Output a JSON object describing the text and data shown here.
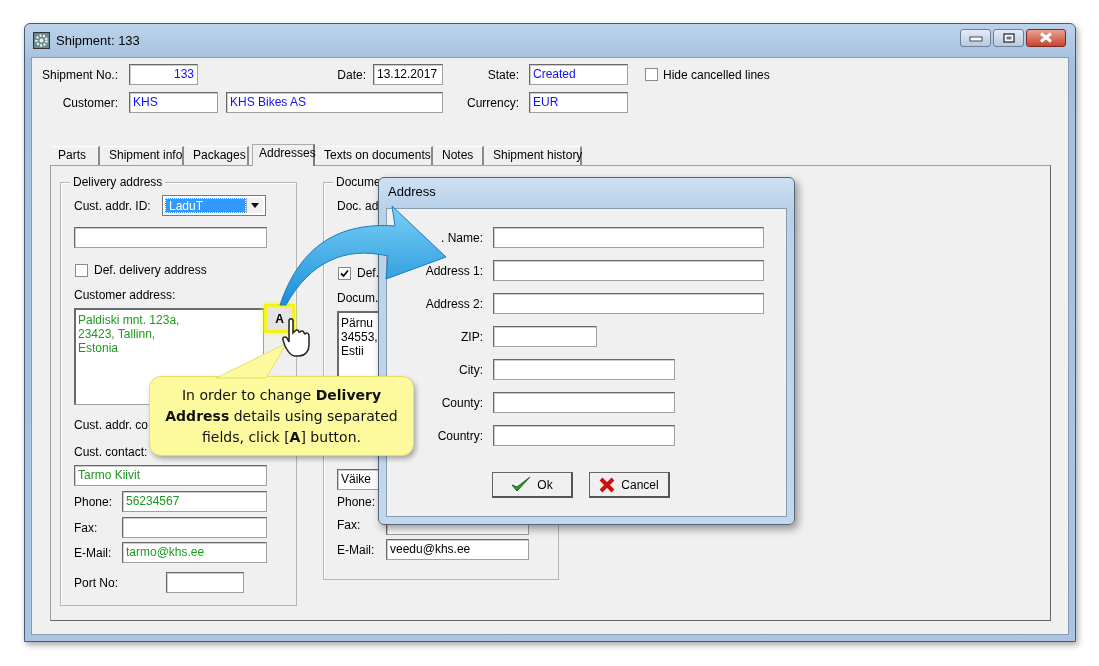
{
  "window": {
    "title": "Shipment: 133"
  },
  "header": {
    "shipment_no": {
      "label": "Shipment No.:",
      "value": "133"
    },
    "date": {
      "label": "Date:",
      "value": "13.12.2017"
    },
    "state": {
      "label": "State:",
      "value": "Created"
    },
    "hide_cancelled": {
      "label": "Hide cancelled lines",
      "checked": false
    },
    "customer": {
      "label": "Customer:",
      "code": "KHS",
      "name": "KHS Bikes AS"
    },
    "currency": {
      "label": "Currency:",
      "value": "EUR"
    }
  },
  "tabs": [
    {
      "label": "Parts",
      "selected": false
    },
    {
      "label": "Shipment info",
      "selected": false
    },
    {
      "label": "Packages",
      "selected": false
    },
    {
      "label": "Addresses",
      "selected": true
    },
    {
      "label": "Texts on documents",
      "selected": false
    },
    {
      "label": "Notes",
      "selected": false
    },
    {
      "label": "Shipment history",
      "selected": false
    }
  ],
  "delivery_address": {
    "title": "Delivery address",
    "cust_addr_id": {
      "label": "Cust. addr. ID:",
      "value": "LaduT"
    },
    "default": {
      "label": "Def. delivery address",
      "checked": false
    },
    "address_label": "Customer address:",
    "address_lines": [
      "Paldiski mnt. 123a,",
      "23423, Tallinn,",
      "Estonia"
    ],
    "address_button": "A",
    "country_label": "Cust. addr. co",
    "contact": {
      "label": "Cust. contact:",
      "value": "Tarmo Kiivit"
    },
    "phone": {
      "label": "Phone:",
      "value": "56234567"
    },
    "fax": {
      "label": "Fax:"
    },
    "email": {
      "label": "E-Mail:",
      "value": "tarmo@khs.ee"
    },
    "port": {
      "label": "Port No:"
    }
  },
  "document_address": {
    "title": "Docume",
    "doc_addr_label": "Doc. ad",
    "default": {
      "label": "Def.",
      "checked": true
    },
    "address_label": "Docum.",
    "address_lines": [
      "Pärnu",
      "34553,",
      "Estii"
    ],
    "contact_value": "Väike",
    "phone": {
      "label": "Phone:"
    },
    "fax": {
      "label": "Fax:"
    },
    "email": {
      "label": "E-Mail:",
      "value": "veedu@khs.ee"
    }
  },
  "dialog": {
    "title": "Address",
    "fields": [
      {
        "label": ". Name:"
      },
      {
        "label": "Address 1:"
      },
      {
        "label": "Address 2:"
      },
      {
        "label": "ZIP:"
      },
      {
        "label": "City:"
      },
      {
        "label": "County:"
      },
      {
        "label": "Country:"
      }
    ],
    "buttons": [
      {
        "label": "Ok",
        "kind": "ok"
      },
      {
        "label": "Cancel",
        "kind": "cancel"
      }
    ]
  },
  "callout": {
    "text": "In order to change **Delivery Address** details using separated fields, click [**A**] button."
  }
}
